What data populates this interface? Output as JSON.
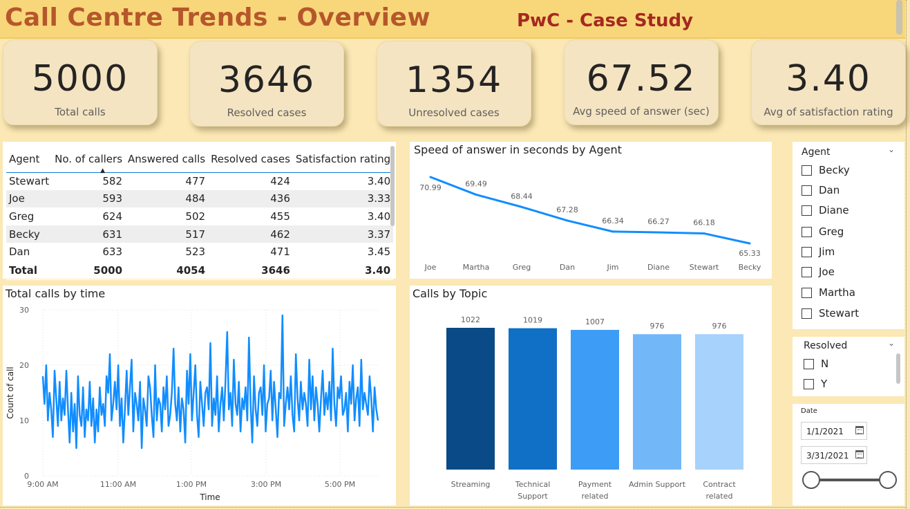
{
  "header": {
    "title": "Call Centre Trends - Overview",
    "subtitle": "PwC - Case Study"
  },
  "kpis": [
    {
      "value": "5000",
      "label": "Total calls"
    },
    {
      "value": "3646",
      "label": "Resolved cases"
    },
    {
      "value": "1354",
      "label": "Unresolved cases"
    },
    {
      "value": "67.52",
      "label": "Avg speed of answer (sec)"
    },
    {
      "value": "3.40",
      "label": "Avg of satisfaction rating"
    }
  ],
  "agent_table": {
    "columns": [
      "Agent",
      "No. of callers",
      "Answered calls",
      "Resolved cases",
      "Satisfaction rating"
    ],
    "rows": [
      [
        "Stewart",
        "582",
        "477",
        "424",
        "3.40"
      ],
      [
        "Joe",
        "593",
        "484",
        "436",
        "3.33"
      ],
      [
        "Greg",
        "624",
        "502",
        "455",
        "3.40"
      ],
      [
        "Becky",
        "631",
        "517",
        "462",
        "3.37"
      ],
      [
        "Dan",
        "633",
        "523",
        "471",
        "3.45"
      ]
    ],
    "total": [
      "Total",
      "5000",
      "4054",
      "3646",
      "3.40"
    ]
  },
  "speed_chart": {
    "title": "Speed of answer in seconds by Agent",
    "color": "#118dff"
  },
  "time_chart": {
    "title": "Total calls by time",
    "color": "#118dff"
  },
  "topic_chart": {
    "title": "Calls by Topic",
    "labels_line1": [
      "Streaming",
      "Technical",
      "Payment",
      "Admin Support",
      "Contract"
    ],
    "labels_line2": [
      "",
      "Support",
      "related",
      "",
      "related"
    ]
  },
  "chart_data": [
    {
      "type": "line",
      "title": "Speed of answer in seconds by Agent",
      "categories": [
        "Joe",
        "Martha",
        "Greg",
        "Dan",
        "Jim",
        "Diane",
        "Stewart",
        "Becky"
      ],
      "values": [
        70.99,
        69.49,
        68.44,
        67.28,
        66.34,
        66.27,
        66.18,
        65.33
      ],
      "data_labels": [
        "70.99",
        "69.49",
        "68.44",
        "67.28",
        "66.34",
        "66.27",
        "66.18",
        "65.33"
      ]
    },
    {
      "type": "line",
      "title": "Total calls by time",
      "xlabel": "Time",
      "ylabel": "Count of call",
      "ylim": [
        0,
        30
      ],
      "yticks": [
        "0",
        "10",
        "20",
        "30"
      ],
      "xticks": [
        "9:00 AM",
        "11:00 AM",
        "1:00 PM",
        "3:00 PM",
        "5:00 PM"
      ],
      "grid": true,
      "values": [
        18,
        13,
        20,
        10,
        15,
        12,
        7,
        19,
        14,
        9,
        17,
        10,
        14,
        11,
        19,
        12,
        6,
        15,
        8,
        13,
        5,
        18,
        11,
        9,
        16,
        7,
        12,
        10,
        17,
        9,
        14,
        6,
        12,
        8,
        16,
        11,
        13,
        9,
        18,
        15,
        22,
        10,
        13,
        17,
        12,
        20,
        9,
        14,
        6,
        12,
        19,
        11,
        16,
        21,
        8,
        15,
        13,
        10,
        17,
        5,
        14,
        12,
        9,
        18,
        16,
        11,
        7,
        20,
        10,
        14,
        13,
        8,
        16,
        12,
        18,
        9,
        11,
        15,
        23,
        13,
        10,
        16,
        8,
        14,
        12,
        6,
        19,
        13,
        22,
        10,
        15,
        20,
        11,
        7,
        17,
        13,
        9,
        15,
        16,
        12,
        24,
        9,
        14,
        11,
        18,
        8,
        13,
        16,
        10,
        17,
        26,
        12,
        15,
        9,
        21,
        13,
        11,
        17,
        8,
        14,
        12,
        16,
        10,
        25,
        13,
        6,
        18,
        12,
        9,
        15,
        16,
        11,
        20,
        8,
        13,
        14,
        19,
        10,
        17,
        12,
        7,
        15,
        14,
        29,
        9,
        13,
        16,
        12,
        18,
        11,
        8,
        22,
        14,
        10,
        17,
        12,
        15,
        13,
        9,
        21,
        12,
        18,
        10,
        16,
        13,
        8,
        14,
        19,
        11,
        15,
        12,
        17,
        10,
        23,
        13,
        9,
        16,
        14,
        18,
        11,
        12,
        15,
        8,
        17,
        13,
        20,
        10,
        14,
        16,
        9,
        21,
        12,
        15,
        13,
        11,
        18,
        14,
        8,
        16,
        12,
        10
      ],
      "values_note_removed": true
    },
    {
      "type": "bar",
      "title": "Calls by Topic",
      "categories": [
        "Streaming",
        "Technical Support",
        "Payment related",
        "Admin Support",
        "Contract related"
      ],
      "values": [
        1022,
        1019,
        1007,
        976,
        976
      ],
      "colors": [
        "#0a4a86",
        "#1070c6",
        "#3d9cf5",
        "#72b8f8",
        "#a6d2fb"
      ]
    }
  ],
  "agent_slicer": {
    "title": "Agent",
    "items": [
      "Becky",
      "Dan",
      "Diane",
      "Greg",
      "Jim",
      "Joe",
      "Martha",
      "Stewart"
    ]
  },
  "resolved_slicer": {
    "title": "Resolved",
    "items": [
      "N",
      "Y"
    ]
  },
  "date_slicer": {
    "title": "Date",
    "start": "1/1/2021",
    "end": "3/31/2021"
  }
}
